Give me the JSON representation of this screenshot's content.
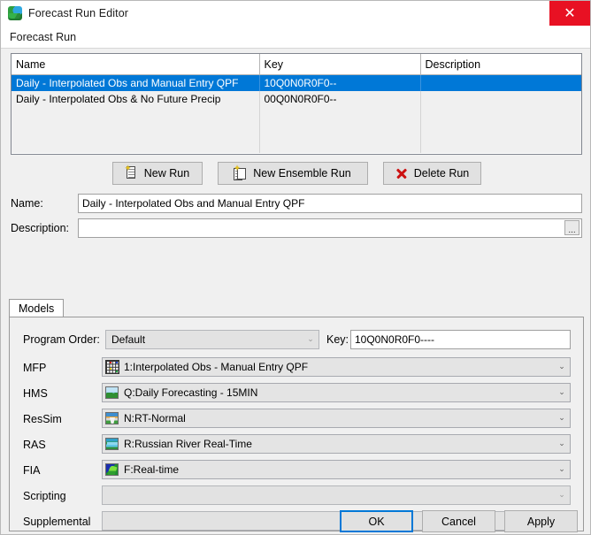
{
  "window": {
    "title": "Forecast Run Editor",
    "app_icon": "globe-icon",
    "close_label": "✕"
  },
  "menubar": {
    "items": [
      {
        "label": "Forecast Run"
      }
    ]
  },
  "table": {
    "headers": [
      "Name",
      "Key",
      "Description"
    ],
    "rows": [
      {
        "name": "Daily - Interpolated Obs and Manual Entry QPF",
        "key": "10Q0N0R0F0--",
        "description": "",
        "selected": true
      },
      {
        "name": "Daily - Interpolated Obs & No Future Precip",
        "key": "00Q0N0R0F0--",
        "description": "",
        "selected": false
      }
    ]
  },
  "actions": {
    "new_run": "New Run",
    "new_ensemble_run": "New Ensemble Run",
    "delete_run": "Delete Run"
  },
  "fields": {
    "name_label": "Name:",
    "name_value": "Daily - Interpolated Obs and Manual Entry QPF",
    "description_label": "Description:",
    "description_value": "",
    "description_browse": "..."
  },
  "tabs": [
    {
      "label": "Models",
      "active": true
    }
  ],
  "models_panel": {
    "program_order_label": "Program Order:",
    "program_order_value": "Default",
    "key_label": "Key:",
    "key_value": "10Q0N0R0F0----",
    "rows": [
      {
        "label": "MFP",
        "value": "1:Interpolated Obs - Manual Entry QPF",
        "icon": "grid-icon",
        "disabled": false
      },
      {
        "label": "HMS",
        "value": "Q:Daily Forecasting - 15MIN",
        "icon": "landscape-icon",
        "disabled": false
      },
      {
        "label": "ResSim",
        "value": "N:RT-Normal",
        "icon": "dam-icon",
        "disabled": false
      },
      {
        "label": "RAS",
        "value": "R:Russian River Real-Time",
        "icon": "river-icon",
        "disabled": false
      },
      {
        "label": "FIA",
        "value": "F:Real-time",
        "icon": "map-icon",
        "disabled": false
      },
      {
        "label": "Scripting",
        "value": "",
        "icon": "",
        "disabled": true
      },
      {
        "label": "Supplemental",
        "value": "",
        "icon": "",
        "disabled": true
      }
    ]
  },
  "dialog_buttons": {
    "ok": "OK",
    "cancel": "Cancel",
    "apply": "Apply"
  },
  "colors": {
    "selection": "#0078d7",
    "close": "#e81123",
    "delete_x": "#cc1111",
    "window_bg": "#f0f0f0"
  }
}
